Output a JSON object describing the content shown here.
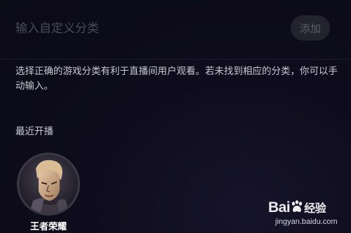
{
  "input": {
    "placeholder": "输入自定义分类",
    "value": ""
  },
  "add_button_label": "添加",
  "hint": "选择正确的游戏分类有利于直播间用户观看。若未找到相应的分类，你可以手动输入。",
  "recent": {
    "title": "最近开播",
    "items": [
      {
        "name": "王者荣耀",
        "icon": "game-character-avatar"
      }
    ]
  },
  "watermark": {
    "logo_prefix": "Bai",
    "logo_suffix": "经验",
    "url": "jingyan.baidu.com",
    "icon": "paw-icon"
  },
  "colors": {
    "background": "#0b0a17",
    "button_bg": "#23222f",
    "button_text": "#5e5d6a",
    "placeholder": "#4a4a58",
    "text": "#c9c9d3"
  }
}
